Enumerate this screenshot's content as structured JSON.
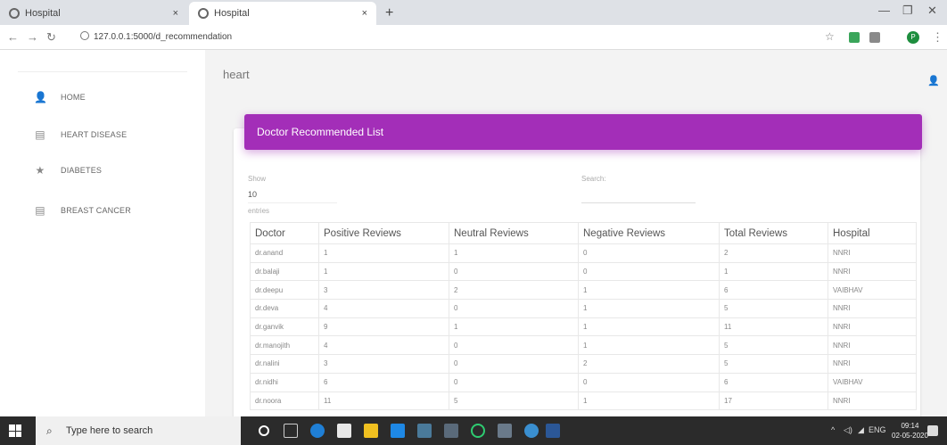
{
  "browser": {
    "tabs": [
      {
        "title": "Hospital"
      },
      {
        "title": "Hospital"
      }
    ],
    "close_glyph": "×",
    "new_tab_glyph": "+",
    "url": "127.0.0.1:5000/d_recommendation",
    "profile_initial": "P"
  },
  "sidebar": {
    "items": [
      {
        "label": "HOME",
        "icon": "person-icon",
        "glyph": "👤"
      },
      {
        "label": "HEART DISEASE",
        "icon": "content-paste-icon",
        "glyph": "▤"
      },
      {
        "label": "DIABETES",
        "icon": "star-icon",
        "glyph": "★"
      },
      {
        "label": "BREAST CANCER",
        "icon": "content-paste-icon",
        "glyph": "▤"
      }
    ]
  },
  "page": {
    "title": "heart",
    "card_title": "Doctor Recommended List",
    "show_label": "Show",
    "show_value": "10",
    "entries_label": "entries",
    "search_label": "Search:"
  },
  "table": {
    "columns": [
      "Doctor",
      "Positive Reviews",
      "Neutral Reviews",
      "Negative Reviews",
      "Total Reviews",
      "Hospital"
    ],
    "rows": [
      [
        "dr.anand",
        "1",
        "1",
        "0",
        "2",
        "NNRI"
      ],
      [
        "dr.balaji",
        "1",
        "0",
        "0",
        "1",
        "NNRI"
      ],
      [
        "dr.deepu",
        "3",
        "2",
        "1",
        "6",
        "VAIBHAV"
      ],
      [
        "dr.deva",
        "4",
        "0",
        "1",
        "5",
        "NNRI"
      ],
      [
        "dr.ganvik",
        "9",
        "1",
        "1",
        "11",
        "NNRI"
      ],
      [
        "dr.manojith",
        "4",
        "0",
        "1",
        "5",
        "NNRI"
      ],
      [
        "dr.nalini",
        "3",
        "0",
        "2",
        "5",
        "NNRI"
      ],
      [
        "dr.nidhi",
        "6",
        "0",
        "0",
        "6",
        "VAIBHAV"
      ],
      [
        "dr.noora",
        "11",
        "5",
        "1",
        "17",
        "NNRI"
      ]
    ]
  },
  "taskbar": {
    "search_placeholder": "Type here to search",
    "lang": "ENG",
    "time": "09:14",
    "date": "02-05-2020"
  },
  "colors": {
    "card_header": "#a32eb8"
  }
}
